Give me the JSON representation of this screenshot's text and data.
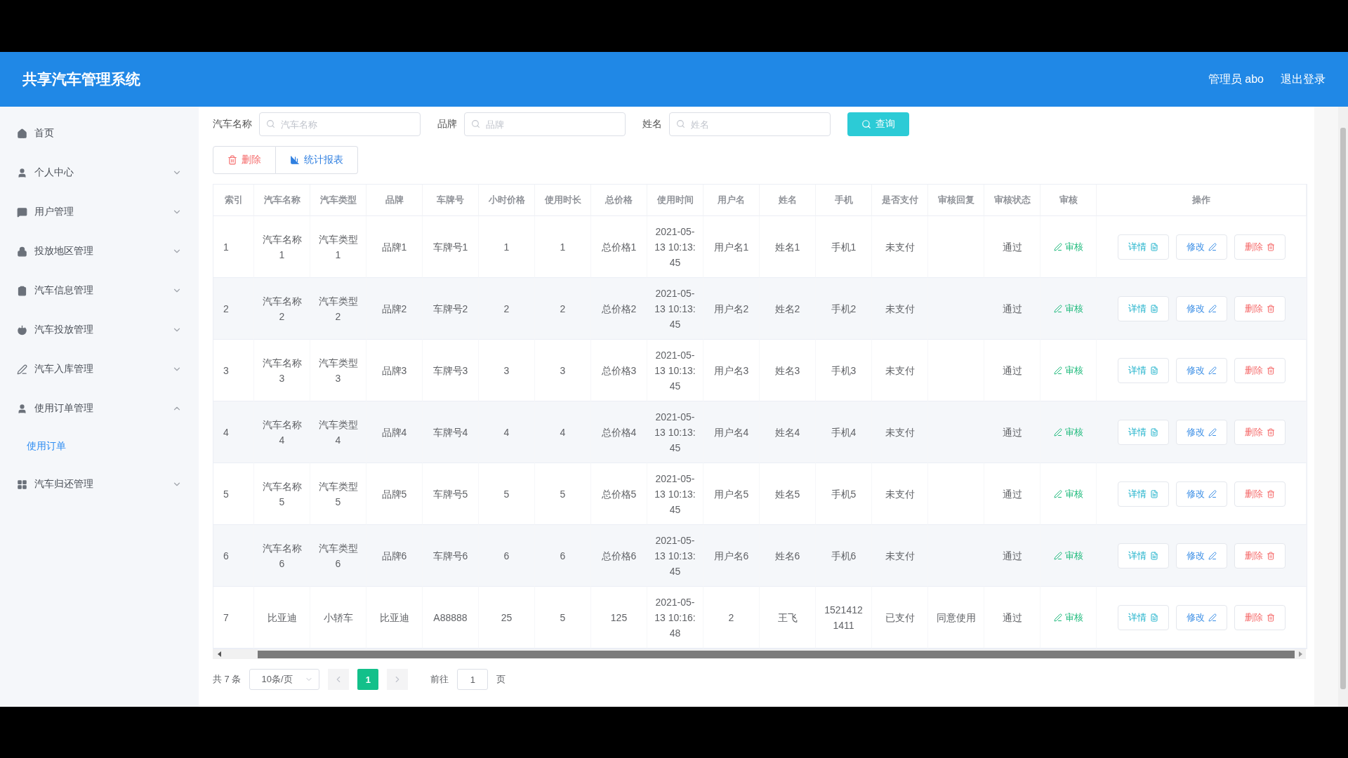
{
  "header": {
    "title": "共享汽车管理系统",
    "user": "管理员 abo",
    "logout": "退出登录"
  },
  "sidebar": {
    "items": [
      {
        "label": "首页"
      },
      {
        "label": "个人中心",
        "expanded": false
      },
      {
        "label": "用户管理",
        "expanded": false
      },
      {
        "label": "投放地区管理",
        "expanded": false
      },
      {
        "label": "汽车信息管理",
        "expanded": false
      },
      {
        "label": "汽车投放管理",
        "expanded": false
      },
      {
        "label": "汽车入库管理",
        "expanded": false
      },
      {
        "label": "使用订单管理",
        "expanded": true,
        "children": [
          {
            "label": "使用订单",
            "selected": true
          }
        ]
      },
      {
        "label": "汽车归还管理",
        "expanded": false
      }
    ]
  },
  "search": {
    "fields": [
      {
        "label": "汽车名称",
        "placeholder": "汽车名称"
      },
      {
        "label": "品牌",
        "placeholder": "品牌"
      },
      {
        "label": "姓名",
        "placeholder": "姓名"
      }
    ],
    "button": "查询"
  },
  "toolbar": [
    {
      "label": "删除",
      "kind": "danger"
    },
    {
      "label": "统计报表",
      "kind": "chart"
    }
  ],
  "table": {
    "columns": [
      "索引",
      "汽车名称",
      "汽车类型",
      "品牌",
      "车牌号",
      "小时价格",
      "使用时长",
      "总价格",
      "使用时间",
      "用户名",
      "姓名",
      "手机",
      "是否支付",
      "审核回复",
      "审核状态",
      "审核",
      "操作"
    ],
    "rows": [
      {
        "cells": [
          "1",
          "汽车名称1",
          "汽车类型1",
          "品牌1",
          "车牌号1",
          "1",
          "1",
          "总价格1",
          "2021-05-13 10:13:45",
          "用户名1",
          "姓名1",
          "手机1",
          "未支付",
          "",
          "通过"
        ],
        "audit": "审核",
        "actions": [
          "详情",
          "修改",
          "删除"
        ]
      },
      {
        "cells": [
          "2",
          "汽车名称2",
          "汽车类型2",
          "品牌2",
          "车牌号2",
          "2",
          "2",
          "总价格2",
          "2021-05-13 10:13:45",
          "用户名2",
          "姓名2",
          "手机2",
          "未支付",
          "",
          "通过"
        ],
        "audit": "审核",
        "actions": [
          "详情",
          "修改",
          "删除"
        ]
      },
      {
        "cells": [
          "3",
          "汽车名称3",
          "汽车类型3",
          "品牌3",
          "车牌号3",
          "3",
          "3",
          "总价格3",
          "2021-05-13 10:13:45",
          "用户名3",
          "姓名3",
          "手机3",
          "未支付",
          "",
          "通过"
        ],
        "audit": "审核",
        "actions": [
          "详情",
          "修改",
          "删除"
        ]
      },
      {
        "cells": [
          "4",
          "汽车名称4",
          "汽车类型4",
          "品牌4",
          "车牌号4",
          "4",
          "4",
          "总价格4",
          "2021-05-13 10:13:45",
          "用户名4",
          "姓名4",
          "手机4",
          "未支付",
          "",
          "通过"
        ],
        "audit": "审核",
        "actions": [
          "详情",
          "修改",
          "删除"
        ]
      },
      {
        "cells": [
          "5",
          "汽车名称5",
          "汽车类型5",
          "品牌5",
          "车牌号5",
          "5",
          "5",
          "总价格5",
          "2021-05-13 10:13:45",
          "用户名5",
          "姓名5",
          "手机5",
          "未支付",
          "",
          "通过"
        ],
        "audit": "审核",
        "actions": [
          "详情",
          "修改",
          "删除"
        ]
      },
      {
        "cells": [
          "6",
          "汽车名称6",
          "汽车类型6",
          "品牌6",
          "车牌号6",
          "6",
          "6",
          "总价格6",
          "2021-05-13 10:13:45",
          "用户名6",
          "姓名6",
          "手机6",
          "未支付",
          "",
          "通过"
        ],
        "audit": "审核",
        "actions": [
          "详情",
          "修改",
          "删除"
        ]
      },
      {
        "cells": [
          "7",
          "比亚迪",
          "小轿车",
          "比亚迪",
          "A88888",
          "25",
          "5",
          "125",
          "2021-05-13 10:16:48",
          "2",
          "王飞",
          "15214121411",
          "已支付",
          "同意使用",
          "通过"
        ],
        "audit": "审核",
        "actions": [
          "详情",
          "修改",
          "删除"
        ]
      }
    ]
  },
  "pagination": {
    "total": "共 7 条",
    "page_size": "10条/页",
    "pages": [
      {
        "label": "1",
        "selected": true
      }
    ],
    "goto_label": "前往",
    "goto_value": "1",
    "page_unit": "页"
  }
}
